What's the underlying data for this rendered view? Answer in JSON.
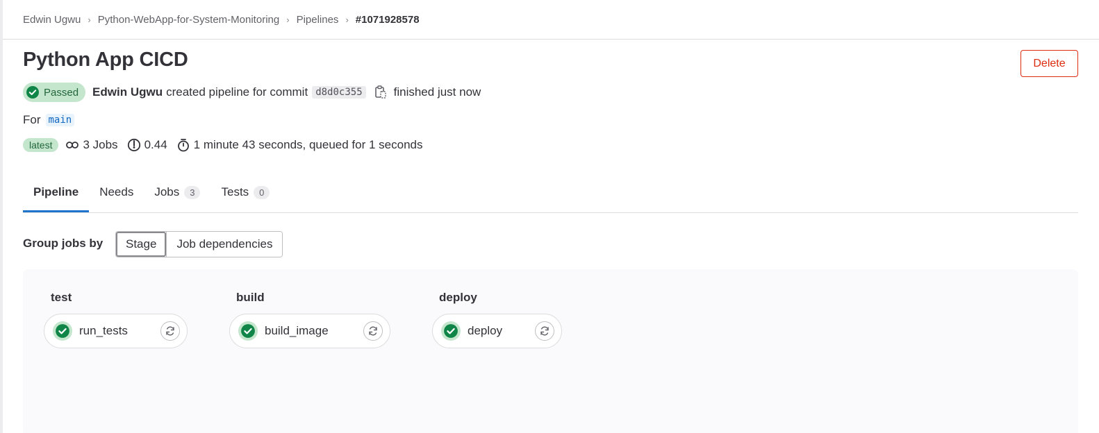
{
  "breadcrumb": {
    "items": [
      "Edwin Ugwu",
      "Python-WebApp-for-System-Monitoring",
      "Pipelines",
      "#1071928578"
    ],
    "separator": "›"
  },
  "header": {
    "title": "Python App CICD",
    "delete_label": "Delete"
  },
  "meta": {
    "status": "Passed",
    "author": "Edwin Ugwu",
    "action_text": "created pipeline for commit",
    "commit_sha": "d8d0c355",
    "finished_text": "finished just now"
  },
  "ref": {
    "prefix": "For",
    "branch": "main"
  },
  "stats": {
    "latest_badge": "latest",
    "jobs": "3 Jobs",
    "compute": "0.44",
    "duration": "1 minute 43 seconds, queued for 1 seconds"
  },
  "tabs": [
    {
      "label": "Pipeline",
      "count": null
    },
    {
      "label": "Needs",
      "count": null
    },
    {
      "label": "Jobs",
      "count": "3"
    },
    {
      "label": "Tests",
      "count": "0"
    }
  ],
  "group_by": {
    "label": "Group jobs by",
    "options": [
      "Stage",
      "Job dependencies"
    ],
    "selected": "Stage"
  },
  "stages": [
    {
      "name": "test",
      "job": "run_tests"
    },
    {
      "name": "build",
      "job": "build_image"
    },
    {
      "name": "deploy",
      "job": "deploy"
    }
  ],
  "colors": {
    "success": "#108548",
    "success_bg": "#c3e6cd",
    "danger": "#dd2b0e",
    "link_blue": "#1f75cb"
  }
}
